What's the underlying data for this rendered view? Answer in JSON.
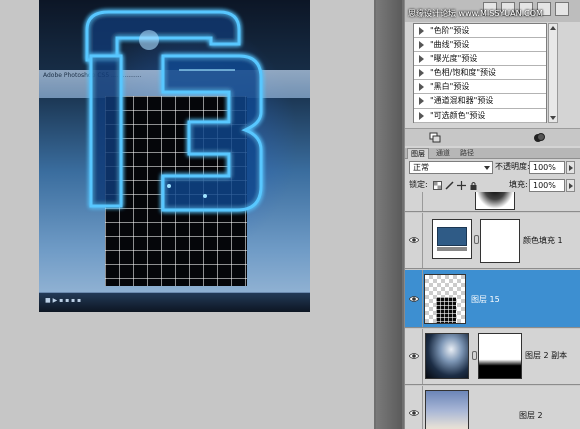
{
  "canvas": {
    "doc_bar_text": "Adobe Photoshop CS5 ................",
    "taskbar_text": "■ ▶ ▪ ▪ ▪ ▪"
  },
  "watermark": "思缘设计论坛 www.MISSYUAN.COM",
  "adjustments": {
    "presets": [
      "\"色阶\"预设",
      "\"曲线\"预设",
      "\"曝光度\"预设",
      "\"色相/饱和度\"预设",
      "\"黑白\"预设",
      "\"通道混和器\"预设",
      "\"可选颜色\"预设"
    ]
  },
  "layers_panel": {
    "tabs": [
      "图层",
      "通道",
      "路径"
    ],
    "blend_mode": "正常",
    "opacity_label": "不透明度:",
    "opacity_value": "100%",
    "lock_label": "锁定:",
    "fill_label": "填充:",
    "fill_value": "100%",
    "layers": [
      {
        "name": "",
        "selected": false
      },
      {
        "name": "颜色填充 1",
        "selected": false
      },
      {
        "name": "图层 15",
        "selected": true
      },
      {
        "name": "图层 2 副本",
        "selected": false
      },
      {
        "name": "图层 2",
        "selected": false
      }
    ]
  },
  "colors": {
    "selection": "#3d8fd1",
    "panel": "#d4d4d4",
    "fill_swatch": "#2f5b86",
    "neon": "#59c7ff"
  },
  "icons": [
    "visibility-eye-icon",
    "link-chain-icon",
    "disclosure-triangle-icon",
    "lock-icon",
    "move-icon",
    "brush-icon"
  ]
}
